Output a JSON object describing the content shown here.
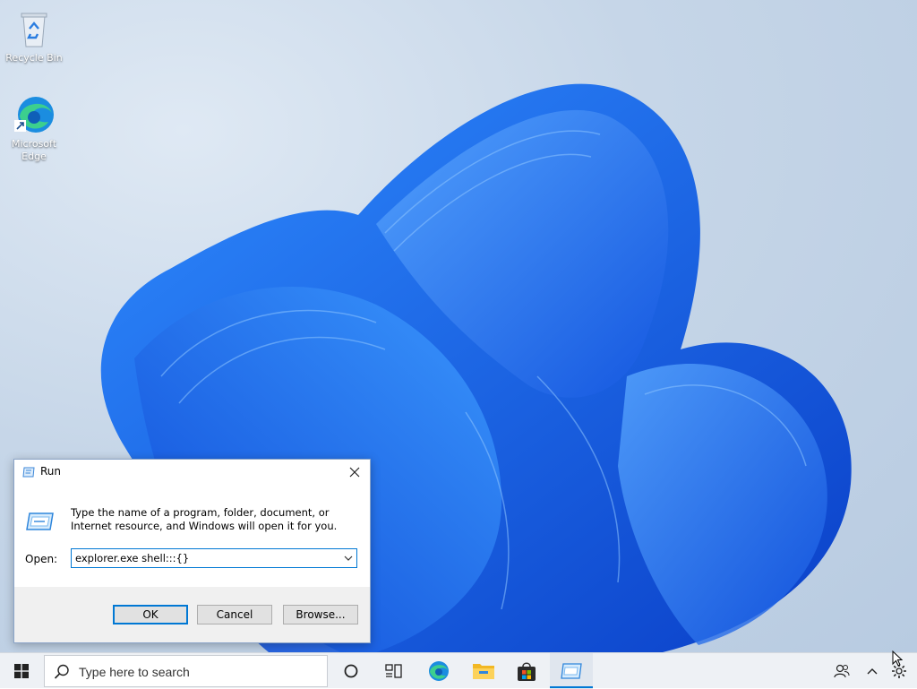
{
  "desktop": {
    "icons": [
      {
        "label": "Recycle Bin"
      },
      {
        "label": "Microsoft Edge"
      }
    ]
  },
  "run_dialog": {
    "title": "Run",
    "description": "Type the name of a program, folder, document, or Internet resource, and Windows will open it for you.",
    "open_label": "Open:",
    "open_value": "explorer.exe shell:::{}",
    "buttons": {
      "ok": "OK",
      "cancel": "Cancel",
      "browse": "Browse..."
    }
  },
  "taskbar": {
    "search_placeholder": "Type here to search",
    "pinned": [
      "start-icon",
      "cortana-icon",
      "task-view-icon",
      "edge-icon",
      "file-explorer-icon",
      "store-icon",
      "run-icon"
    ],
    "tray": [
      "people-icon",
      "show-hidden-icons-icon",
      "settings-icon"
    ]
  },
  "colors": {
    "accent": "#0078d4",
    "wallpaper_bloom": "#1a6ef0",
    "wallpaper_bg": "#c6d6e8"
  }
}
